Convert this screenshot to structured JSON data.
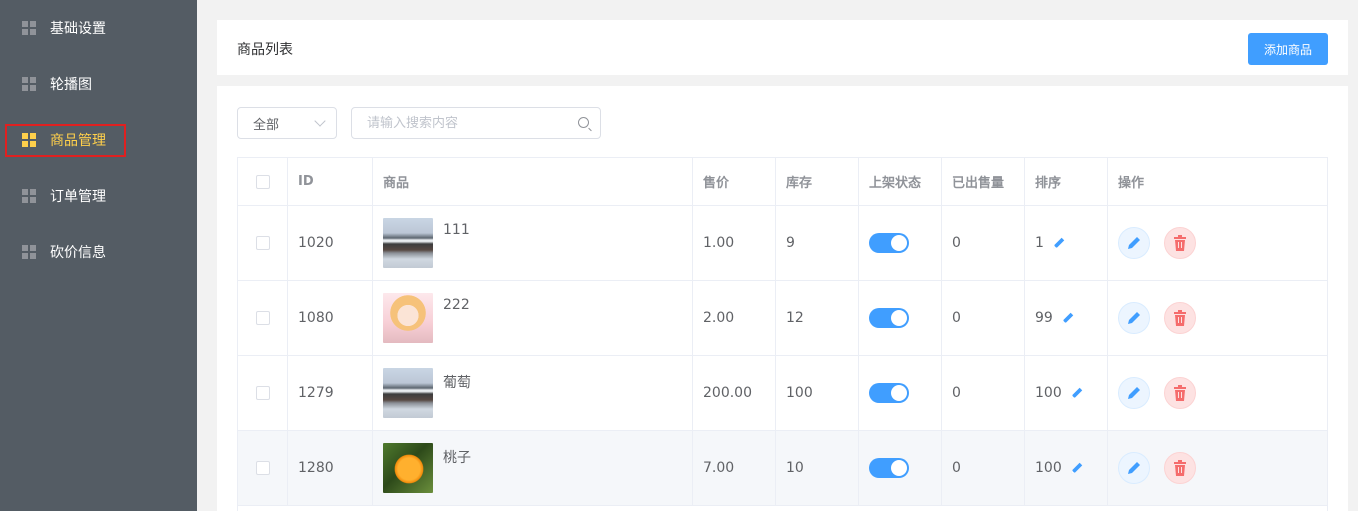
{
  "sidebar": {
    "items": [
      {
        "label": "基础设置",
        "icon": "grid-icon",
        "active": false
      },
      {
        "label": "轮播图",
        "icon": "grid-icon",
        "active": false
      },
      {
        "label": "商品管理",
        "icon": "grid-icon",
        "active": true
      },
      {
        "label": "订单管理",
        "icon": "grid-icon",
        "active": false
      },
      {
        "label": "砍价信息",
        "icon": "grid-icon",
        "active": false
      }
    ]
  },
  "header": {
    "title": "商品列表",
    "add_label": "添加商品"
  },
  "filter": {
    "selected": "全部",
    "search_placeholder": "请输入搜索内容"
  },
  "table": {
    "columns": [
      "ID",
      "商品",
      "售价",
      "库存",
      "上架状态",
      "已出售量",
      "排序",
      "操作"
    ],
    "rows": [
      {
        "id": "1020",
        "name": "111",
        "price": "1.00",
        "stock": "9",
        "on_sale": true,
        "sold": "0",
        "sort": "1"
      },
      {
        "id": "1080",
        "name": "222",
        "price": "2.00",
        "stock": "12",
        "on_sale": true,
        "sold": "0",
        "sort": "99"
      },
      {
        "id": "1279",
        "name": "葡萄",
        "price": "200.00",
        "stock": "100",
        "on_sale": true,
        "sold": "0",
        "sort": "100"
      },
      {
        "id": "1280",
        "name": "桃子",
        "price": "7.00",
        "stock": "10",
        "on_sale": true,
        "sold": "0",
        "sort": "100"
      }
    ]
  },
  "colors": {
    "sidebar_bg": "#545c64",
    "active": "#ffd04b",
    "primary": "#409eff",
    "danger": "#f56c6c"
  }
}
